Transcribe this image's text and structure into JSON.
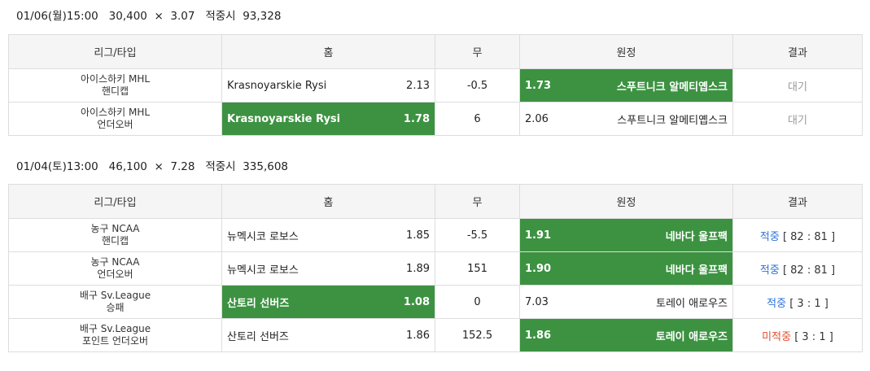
{
  "columns": {
    "league": "리그/타입",
    "home": "홈",
    "draw": "무",
    "away": "원정",
    "result": "결과"
  },
  "slips": [
    {
      "header": {
        "datetime": "01/06(월)15:00",
        "stake": "30,400",
        "times": "×",
        "odds": "3.07",
        "payout_label": "적중시",
        "payout": "93,328"
      },
      "rows": [
        {
          "league": "아이스하키 MHL",
          "type": "핸디캡",
          "home_team": "Krasnoyarskie Rysi",
          "home_odds": "2.13",
          "draw": "-0.5",
          "away_odds": "1.73",
          "away_team": "스푸트니크 알메티옙스크",
          "status": "대기",
          "score": ""
        },
        {
          "league": "아이스하키 MHL",
          "type": "언더오버",
          "home_team": "Krasnoyarskie Rysi",
          "home_odds": "1.78",
          "draw": "6",
          "away_odds": "2.06",
          "away_team": "스푸트니크 알메티옙스크",
          "status": "대기",
          "score": ""
        }
      ]
    },
    {
      "header": {
        "datetime": "01/04(토)13:00",
        "stake": "46,100",
        "times": "×",
        "odds": "7.28",
        "payout_label": "적중시",
        "payout": "335,608"
      },
      "rows": [
        {
          "league": "농구 NCAA",
          "type": "핸디캡",
          "home_team": "뉴멕시코 로보스",
          "home_odds": "1.85",
          "draw": "-5.5",
          "away_odds": "1.91",
          "away_team": "네바다 울프팩",
          "status": "적중",
          "score": "[ 82 : 81 ]"
        },
        {
          "league": "농구 NCAA",
          "type": "언더오버",
          "home_team": "뉴멕시코 로보스",
          "home_odds": "1.89",
          "draw": "151",
          "away_odds": "1.90",
          "away_team": "네바다 울프팩",
          "status": "적중",
          "score": "[ 82 : 81 ]"
        },
        {
          "league": "배구 Sv.League",
          "type": "승패",
          "home_team": "산토리 선버즈",
          "home_odds": "1.08",
          "draw": "0",
          "away_odds": "7.03",
          "away_team": "토레이 애로우즈",
          "status": "적중",
          "score": "[ 3 : 1 ]"
        },
        {
          "league": "배구 Sv.League",
          "type": "포인트 언더오버",
          "home_team": "산토리 선버즈",
          "home_odds": "1.86",
          "draw": "152.5",
          "away_odds": "1.86",
          "away_team": "토레이 애로우즈",
          "status": "미적중",
          "score": "[ 3 : 1 ]"
        }
      ]
    }
  ],
  "colors": {
    "selected": "#3c9241",
    "hit": "#2b72d8",
    "miss": "#e0502c",
    "wait": "#999999"
  }
}
